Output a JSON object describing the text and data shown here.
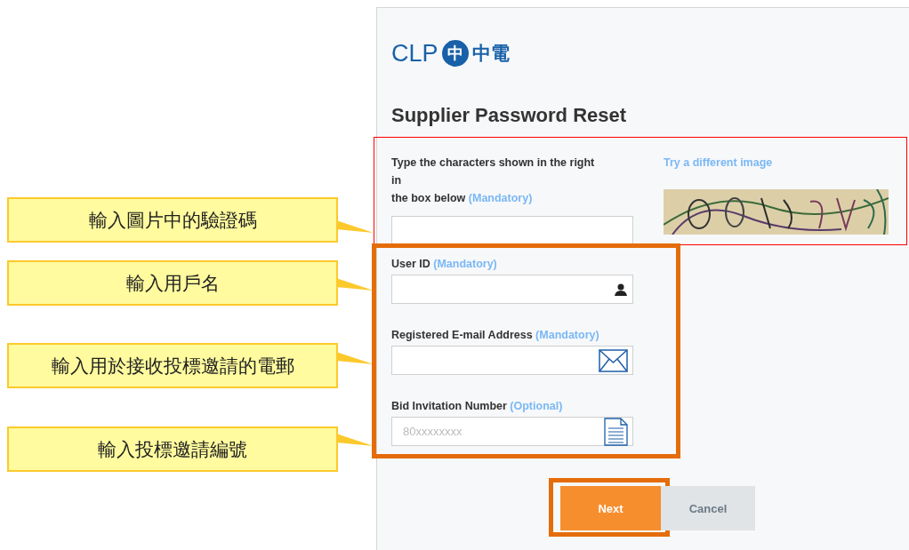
{
  "callouts": [
    {
      "text": "輸入圖片中的驗證碼"
    },
    {
      "text": "輸入用戶名"
    },
    {
      "text": "輸入用於接收投標邀請的電郵"
    },
    {
      "text": "輸入投標邀請編號"
    }
  ],
  "page": {
    "logo": {
      "wordmark": "CLP",
      "emblem": "中",
      "chinese": "中電"
    },
    "title": "Supplier Password Reset",
    "captcha": {
      "label_lines": [
        "Type the characters shown in the right in",
        "the box below"
      ],
      "note": "(Mandatory)",
      "link": "Try a different image",
      "image": {
        "kind": "picture"
      }
    },
    "fields": [
      {
        "label": "User ID",
        "note": "(Mandatory)",
        "kind": "user"
      },
      {
        "label": "Registered E-mail Address",
        "note": "(Mandatory)",
        "kind": "email"
      },
      {
        "label": "Bid Invitation Number",
        "note": "(Optional)",
        "kind": "number",
        "placeholder": "80xxxxxxxx"
      }
    ],
    "buttons": [
      {
        "label": "Next",
        "kind": "primary"
      },
      {
        "label": "Cancel",
        "kind": "secondary"
      }
    ]
  }
}
